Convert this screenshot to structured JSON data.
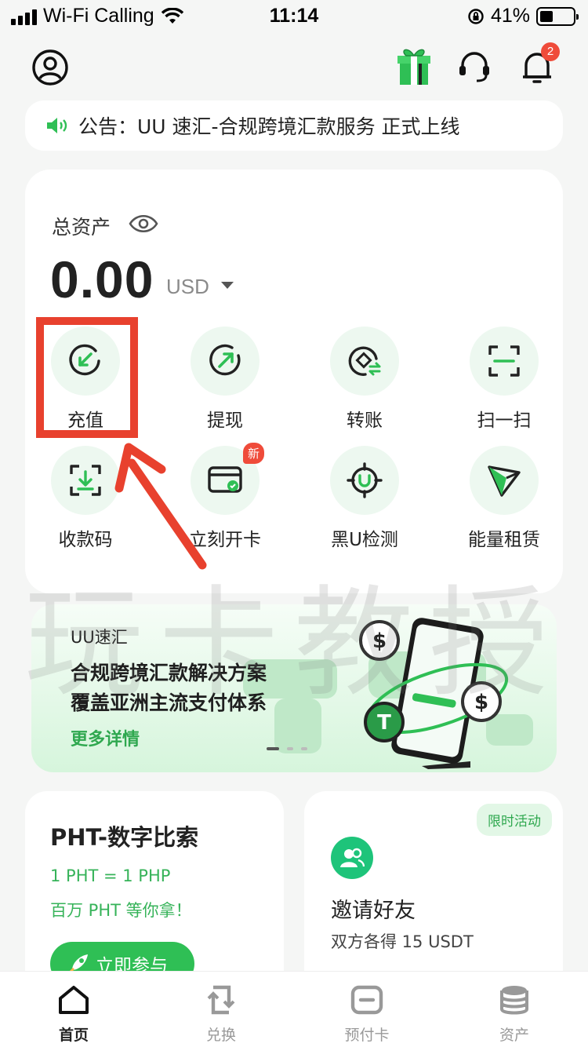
{
  "status": {
    "carrier": "Wi-Fi Calling",
    "time": "11:14",
    "battery": "41%",
    "battery_level": 0.41
  },
  "header": {
    "profile": "profile-icon",
    "gift": "gift-icon",
    "support": "headset-icon",
    "bell": "bell-icon",
    "notif_count": "2"
  },
  "notice": {
    "text": "公告：UU 速汇-合规跨境汇款服务 正式上线"
  },
  "assets": {
    "label": "总资产",
    "value": "0.00",
    "unit": "USD"
  },
  "actions": [
    {
      "label": "充值",
      "icon": "deposit-icon"
    },
    {
      "label": "提现",
      "icon": "withdraw-icon"
    },
    {
      "label": "转账",
      "icon": "transfer-icon"
    },
    {
      "label": "扫一扫",
      "icon": "scan-icon"
    },
    {
      "label": "收款码",
      "icon": "receive-code-icon"
    },
    {
      "label": "立刻开卡",
      "icon": "card-icon",
      "badge": "新"
    },
    {
      "label": "黑U检测",
      "icon": "u-detect-icon"
    },
    {
      "label": "能量租赁",
      "icon": "tron-icon"
    }
  ],
  "banner": {
    "brand": "UU速汇",
    "line1": "合规跨境汇款解决方案",
    "line2": "覆盖亚洲主流支付体系",
    "more": "更多详情"
  },
  "promo_left": {
    "title": "PHT-数字比索",
    "line1": "1 PHT = 1 PHP",
    "line2": "百万 PHT 等你拿！",
    "button": "立即参与"
  },
  "promo_right": {
    "tag": "限时活动",
    "title": "邀请好友",
    "sub": "双方各得 15 USDT"
  },
  "watermark": "玩卡教授",
  "tabs": [
    {
      "label": "首页",
      "icon": "home-icon",
      "active": true
    },
    {
      "label": "兑换",
      "icon": "exchange-icon"
    },
    {
      "label": "预付卡",
      "icon": "prepaid-card-icon"
    },
    {
      "label": "资产",
      "icon": "coins-icon"
    }
  ],
  "colors": {
    "accent": "#2fbf55",
    "highlight": "#e8412e",
    "badge": "#ef4b3a"
  }
}
